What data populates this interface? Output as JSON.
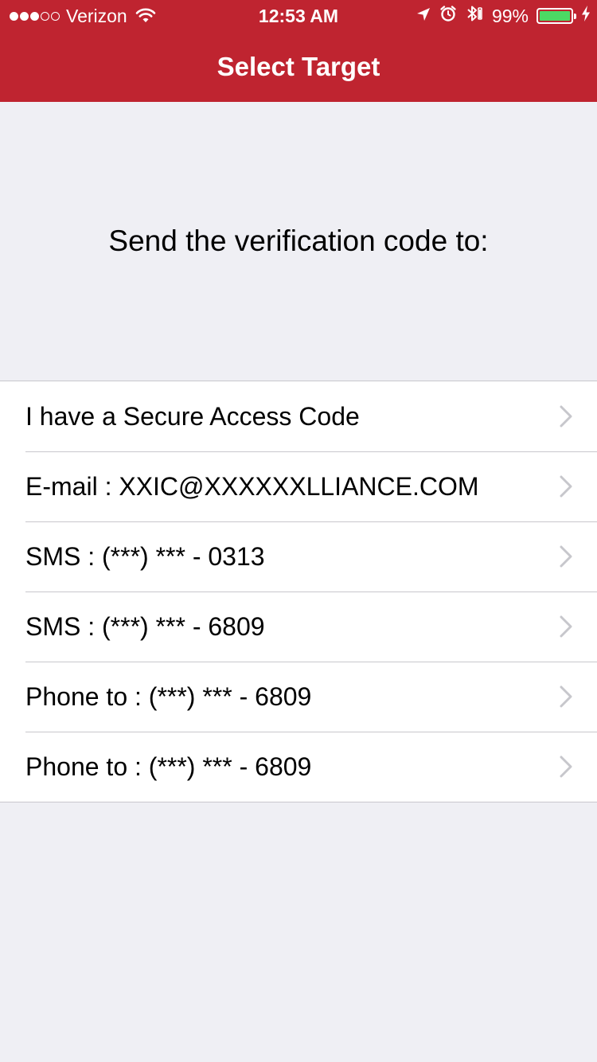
{
  "status_bar": {
    "carrier": "Verizon",
    "signal_bars_filled": 3,
    "signal_bars_total": 5,
    "time": "12:53 AM",
    "battery_percent": "99%",
    "battery_level": 0.99,
    "icons": [
      "wifi-icon",
      "location-arrow-icon",
      "alarm-icon",
      "bluetooth-icon",
      "battery-icon",
      "charging-bolt-icon"
    ]
  },
  "nav": {
    "title": "Select Target"
  },
  "prompt": "Send the verification code to:",
  "options": [
    {
      "label": "I have a Secure Access Code"
    },
    {
      "label": "E-mail : XXIC@XXXXXXLLIANCE.COM"
    },
    {
      "label": "SMS : (***) *** - 0313"
    },
    {
      "label": "SMS : (***) *** - 6809"
    },
    {
      "label": "Phone to : (***) *** - 6809"
    },
    {
      "label": "Phone to : (***) *** - 6809"
    }
  ],
  "colors": {
    "nav_background": "#bf2430",
    "page_background": "#efeff4",
    "battery_fill": "#4cd964",
    "chevron": "#c7c7cc"
  }
}
